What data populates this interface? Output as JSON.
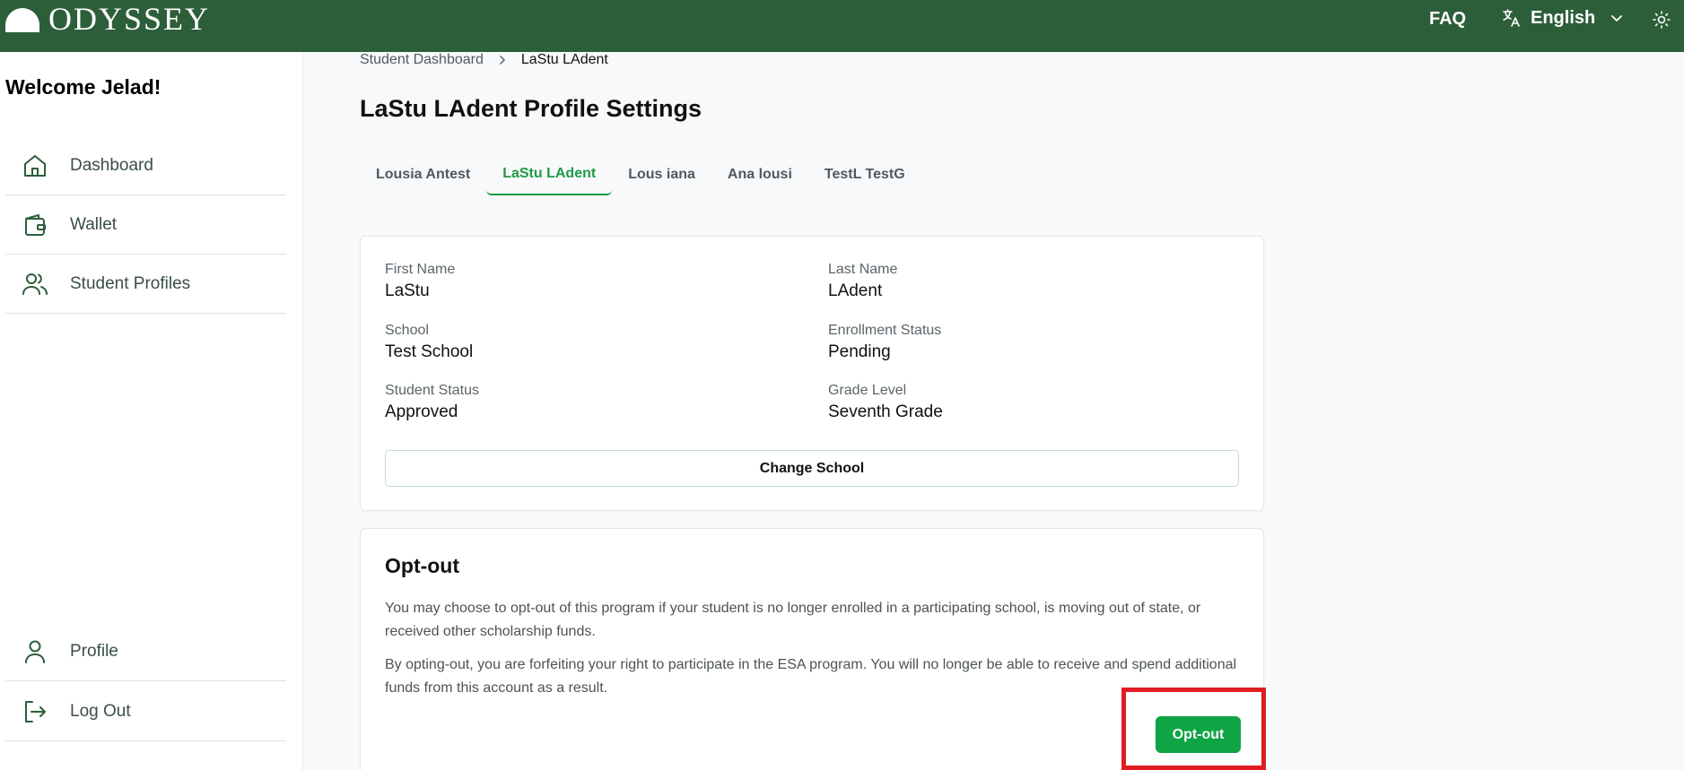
{
  "header": {
    "brand": "ODYSSEY",
    "faq_label": "FAQ",
    "language_label": "English",
    "language_icon": "translate-icon",
    "theme_icon": "sun-icon"
  },
  "sidebar": {
    "welcome": "Welcome Jelad!",
    "items": [
      {
        "label": "Dashboard",
        "icon": "home-icon"
      },
      {
        "label": "Wallet",
        "icon": "wallet-icon"
      },
      {
        "label": "Student Profiles",
        "icon": "users-icon"
      }
    ],
    "bottom_items": [
      {
        "label": "Profile",
        "icon": "user-icon"
      },
      {
        "label": "Log Out",
        "icon": "logout-icon"
      }
    ]
  },
  "breadcrumb": {
    "parent": "Student Dashboard",
    "current": "LaStu LAdent"
  },
  "page": {
    "title": "LaStu LAdent Profile Settings"
  },
  "tabs": [
    {
      "label": "Lousia Antest",
      "active": false
    },
    {
      "label": "LaStu LAdent",
      "active": true
    },
    {
      "label": "Lous iana",
      "active": false
    },
    {
      "label": "Ana lousi",
      "active": false
    },
    {
      "label": "TestL TestG",
      "active": false
    }
  ],
  "profile": {
    "first_name": {
      "label": "First Name",
      "value": "LaStu"
    },
    "last_name": {
      "label": "Last Name",
      "value": "LAdent"
    },
    "school": {
      "label": "School",
      "value": "Test School"
    },
    "enrollment_status": {
      "label": "Enrollment Status",
      "value": "Pending"
    },
    "student_status": {
      "label": "Student Status",
      "value": "Approved"
    },
    "grade_level": {
      "label": "Grade Level",
      "value": "Seventh Grade"
    },
    "change_school_label": "Change School"
  },
  "opt_out": {
    "title": "Opt-out",
    "paragraph1": "You may choose to opt-out of this program if your student is no longer enrolled in a participating school, is moving out of state, or received other scholarship funds.",
    "paragraph2": "By opting-out, you are forfeiting your right to participate in the ESA program. You will no longer be able to receive and spend additional funds from this account as a result.",
    "button_label": "Opt-out"
  },
  "colors": {
    "header_bg": "#2d5e3a",
    "accent_green": "#1e9a48",
    "button_green": "#0fa444",
    "highlight_red": "#e11d22"
  }
}
